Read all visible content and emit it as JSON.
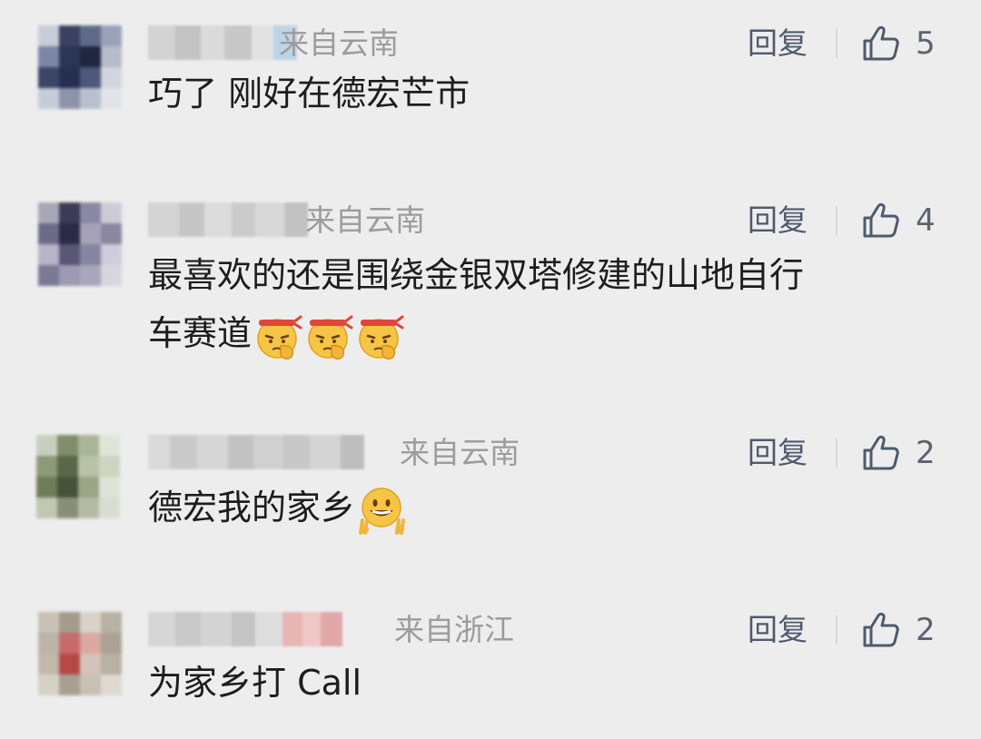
{
  "reply_label": "回复",
  "comments": [
    {
      "avatar_colors": [
        "#c9ccd6",
        "#3a4260",
        "#5f6a8a",
        "#9aa2ba",
        "#7b86a4",
        "#2c3555",
        "#1f2740",
        "#b6bccb",
        "#3b4564",
        "#26304d",
        "#4d587a",
        "#d2d5de",
        "#c7cbd6",
        "#8c94ac",
        "#b9bfce",
        "#e1e3e9"
      ],
      "name_blocks": [
        "#d3d3d3",
        "#c3c3c3",
        "#dadada",
        "#c8c8c8",
        "#e2e2e2",
        "#bcd4e6"
      ],
      "location": "来自云南",
      "likes": "5",
      "text": "巧了 刚好在德宏芒市",
      "text2": "",
      "emoji_count": 0
    },
    {
      "avatar_colors": [
        "#a9a7b6",
        "#3d3a57",
        "#8b88a4",
        "#cdcbd6",
        "#6d6a88",
        "#2d2a48",
        "#a5a2b8",
        "#8a879f",
        "#b8b5c6",
        "#5a5676",
        "#8784a0",
        "#cfcdd9",
        "#7c7995",
        "#9d9ab1",
        "#a9a6bb",
        "#d7d5de"
      ],
      "name_blocks": [
        "#d4d4d4",
        "#c6c6c6",
        "#dcdcdc",
        "#cbcbcb",
        "#d8d8d8",
        "#c2c2c2"
      ],
      "location": "来自云南",
      "likes": "4",
      "text": "最喜欢的还是围绕金银双塔修建的山地自行",
      "text2": "车赛道",
      "emoji_count": 3
    },
    {
      "avatar_colors": [
        "#c9cfc0",
        "#7f8d6c",
        "#a9b598",
        "#e0e4d8",
        "#8d9a7a",
        "#5b6749",
        "#b9c2a8",
        "#cdd4c0",
        "#6f7c5a",
        "#48523a",
        "#9aa585",
        "#dfe3d7",
        "#c0c7b2",
        "#888f78",
        "#b4bba4",
        "#d9ddd1"
      ],
      "name_blocks": [
        "#dadada",
        "#cacaca",
        "#d6d6d6",
        "#c2c2c2",
        "#d0d0d0",
        "#c8c8c8",
        "#d4d4d4",
        "#bebebe"
      ],
      "location": "来自云南",
      "likes": "2",
      "text": "德宏我的家乡",
      "text2": "",
      "emoji_count": 1
    },
    {
      "avatar_colors": [
        "#c7c2b5",
        "#a39c8c",
        "#d8d3c8",
        "#b8b2a4",
        "#bcb4a6",
        "#c96a6a",
        "#d9a9a2",
        "#aaa395",
        "#c1b9ab",
        "#b74848",
        "#d4c3bb",
        "#b9b1a3",
        "#d6d1c6",
        "#a89f90",
        "#c8c1b3",
        "#dedad1"
      ],
      "name_blocks": [
        "#d6d6d6",
        "#c9c9c9",
        "#d3d3d3",
        "#c5c5c5",
        "#dddddd",
        "#e8b5b5",
        "#f0c8c8",
        "#e0a8a8"
      ],
      "location": "来自浙江",
      "likes": "2",
      "text": "为家乡打 Call",
      "text2": "",
      "emoji_count": 0
    }
  ]
}
